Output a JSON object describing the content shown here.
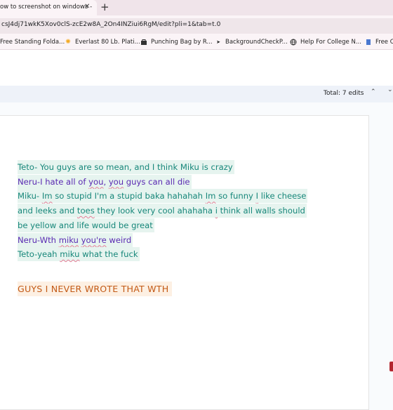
{
  "browser": {
    "tab_title": "ow to screenshot on windows -",
    "tab_close": "✕",
    "new_tab": "+",
    "url": "csJ4dj71wkK5Xov0clS-zcE2w8A_2On4INZiui6RgM/edit?pli=1&tab=t.0",
    "bookmarks": [
      {
        "label": "Free Standing Folda...",
        "icon": "folder-icon"
      },
      {
        "label": "Everlast 80 Lb. Plati...",
        "icon": "sun-icon"
      },
      {
        "label": "Punching Bag by R...",
        "icon": "bag-icon"
      },
      {
        "label": "BackgroundCheckP...",
        "icon": "arrow-icon"
      },
      {
        "label": "Help For College N...",
        "icon": "globe-icon"
      },
      {
        "label": "Free C",
        "icon": "doc-icon"
      }
    ]
  },
  "docs": {
    "total_edits": "Total: 7 edits",
    "prev_edit": "⌃",
    "next_edit": "⌄"
  },
  "document": {
    "lines": [
      {
        "speaker": "teto",
        "parts": [
          "Teto- You guys are so mean, and I think Miku is crazy"
        ]
      },
      {
        "speaker": "neru",
        "parts": [
          "Neru-I hate all of ",
          "you",
          ", ",
          "you",
          " guys can all die"
        ]
      },
      {
        "speaker": "miku",
        "parts": [
          "Miku- ",
          "Im",
          " so stupid I'm a stupid baka hahahah ",
          "Im",
          " so funny ",
          "I",
          " like cheese"
        ]
      },
      {
        "speaker": "miku",
        "parts": [
          "and leeks and ",
          "toes",
          " they look very cool ahahaha ",
          "i",
          " think all walls should"
        ]
      },
      {
        "speaker": "miku",
        "parts": [
          "be yellow and life would be great"
        ]
      },
      {
        "speaker": "neru",
        "parts": [
          "Neru-Wth ",
          "miku",
          " ",
          "you're",
          " weird"
        ]
      },
      {
        "speaker": "teto",
        "parts": [
          "Teto-yeah ",
          "miku",
          " what the fuck"
        ]
      }
    ],
    "closing": "GUYS I NEVER WROTE THAT WTH"
  }
}
